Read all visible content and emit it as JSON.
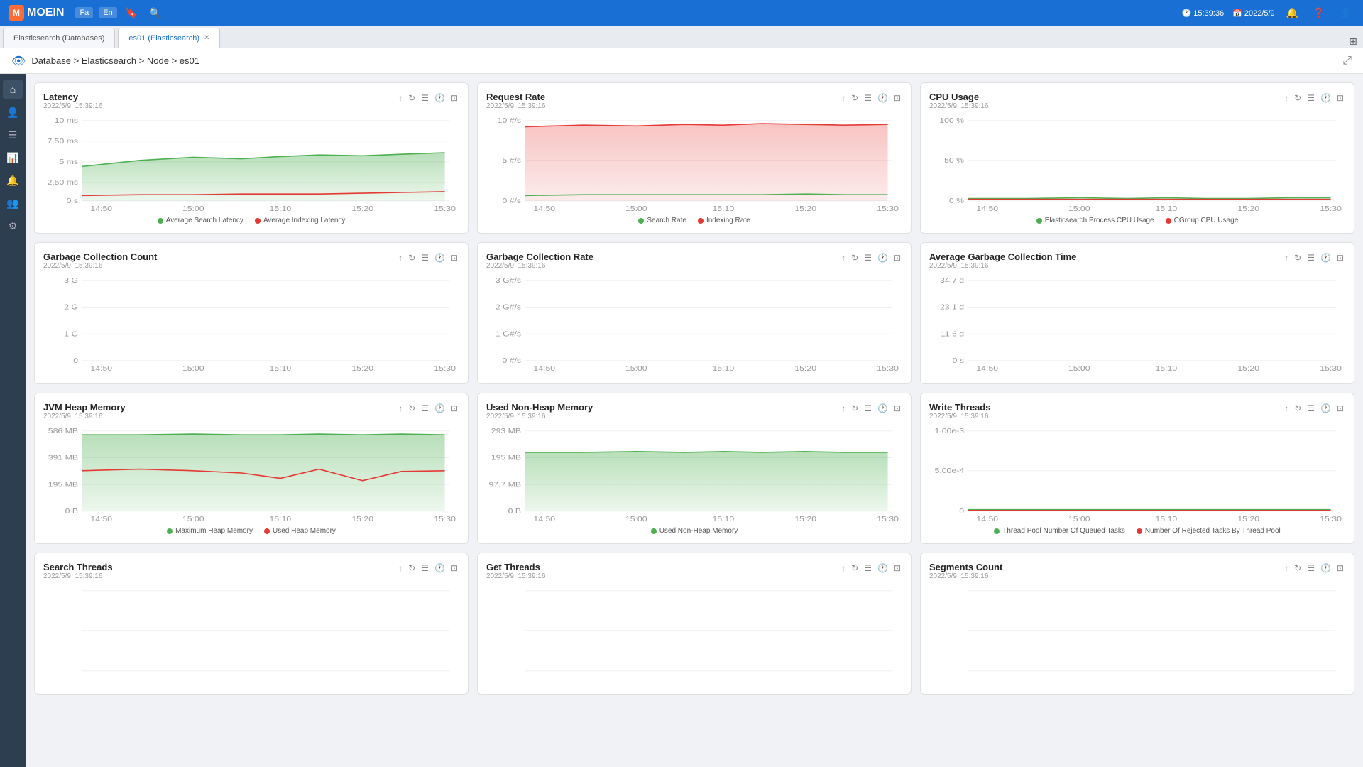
{
  "app": {
    "name": "MOEIN",
    "time": "15:39:36",
    "date": "2022/5/9"
  },
  "tabs": [
    {
      "id": "tab1",
      "label": "Elasticsearch (Databases)",
      "active": false,
      "closable": false
    },
    {
      "id": "tab2",
      "label": "es01 (Elasticsearch)",
      "active": true,
      "closable": true
    }
  ],
  "breadcrumb": "Database > Elasticsearch > Node > es01",
  "lang": {
    "fa": "Fa",
    "en": "En"
  },
  "charts": [
    {
      "id": "latency",
      "title": "Latency",
      "date": "2022/5/9  15:39:16",
      "yLabels": [
        "10 ms",
        "7.50 ms",
        "5 ms",
        "2.50 ms",
        "0 s"
      ],
      "xLabels": [
        "14:50",
        "15:00",
        "15:10",
        "15:20",
        "15:30"
      ],
      "legend": [
        {
          "color": "#4caf50",
          "label": "Average Search Latency"
        },
        {
          "color": "#e53935",
          "label": "Average Indexing Latency"
        }
      ],
      "type": "latency"
    },
    {
      "id": "request-rate",
      "title": "Request Rate",
      "date": "2022/5/9  15:39:16",
      "yLabels": [
        "10 #/s",
        "5 #/s",
        "0 #/s"
      ],
      "xLabels": [
        "14:50",
        "15:00",
        "15:10",
        "15:20",
        "15:30"
      ],
      "legend": [
        {
          "color": "#4caf50",
          "label": "Search Rate"
        },
        {
          "color": "#e53935",
          "label": "Indexing Rate"
        }
      ],
      "type": "request-rate"
    },
    {
      "id": "cpu-usage",
      "title": "CPU Usage",
      "date": "2022/5/9  15:39:16",
      "yLabels": [
        "100 %",
        "50 %",
        "0 %"
      ],
      "xLabels": [
        "14:50",
        "15:00",
        "15:10",
        "15:20",
        "15:30"
      ],
      "legend": [
        {
          "color": "#4caf50",
          "label": "Elasticsearch Process CPU Usage"
        },
        {
          "color": "#e53935",
          "label": "CGroup CPU Usage"
        }
      ],
      "type": "cpu-usage"
    },
    {
      "id": "gc-count",
      "title": "Garbage Collection Count",
      "date": "2022/5/9  15:39:16",
      "yLabels": [
        "3 G",
        "2 G",
        "1 G",
        "0"
      ],
      "xLabels": [
        "14:50",
        "15:00",
        "15:10",
        "15:20",
        "15:30"
      ],
      "legend": [],
      "type": "empty"
    },
    {
      "id": "gc-rate",
      "title": "Garbage Collection Rate",
      "date": "2022/5/9  15:39:16",
      "yLabels": [
        "3 G#/s",
        "2 G#/s",
        "1 G#/s",
        "0 #/s"
      ],
      "xLabels": [
        "14:50",
        "15:00",
        "15:10",
        "15:20",
        "15:30"
      ],
      "legend": [],
      "type": "empty"
    },
    {
      "id": "avg-gc-time",
      "title": "Average Garbage Collection Time",
      "date": "2022/5/9  15:39:16",
      "yLabels": [
        "34.7 d",
        "23.1 d",
        "11.6 d",
        "0 s"
      ],
      "xLabels": [
        "14:50",
        "15:00",
        "15:10",
        "15:20",
        "15:30"
      ],
      "legend": [],
      "type": "empty"
    },
    {
      "id": "jvm-heap",
      "title": "JVM Heap Memory",
      "date": "2022/5/9  15:39:16",
      "yLabels": [
        "586 MB",
        "391 MB",
        "195 MB",
        "0 B"
      ],
      "xLabels": [
        "14:50",
        "15:00",
        "15:10",
        "15:20",
        "15:30"
      ],
      "legend": [
        {
          "color": "#4caf50",
          "label": "Maximum Heap Memory"
        },
        {
          "color": "#e53935",
          "label": "Used Heap Memory"
        }
      ],
      "type": "jvm-heap"
    },
    {
      "id": "non-heap",
      "title": "Used Non-Heap Memory",
      "date": "2022/5/9  15:39:16",
      "yLabels": [
        "293 MB",
        "195 MB",
        "97.7 MB",
        "0 B"
      ],
      "xLabels": [
        "14:50",
        "15:00",
        "15:10",
        "15:20",
        "15:30"
      ],
      "legend": [
        {
          "color": "#4caf50",
          "label": "Used Non-Heap Memory"
        }
      ],
      "type": "non-heap"
    },
    {
      "id": "write-threads",
      "title": "Write Threads",
      "date": "2022/5/9  15:39:16",
      "yLabels": [
        "1.00e-3",
        "5.00e-4",
        "0"
      ],
      "xLabels": [
        "14:50",
        "15:00",
        "15:10",
        "15:20",
        "15:30"
      ],
      "legend": [
        {
          "color": "#4caf50",
          "label": "Thread Pool Number Of Queued Tasks"
        },
        {
          "color": "#e53935",
          "label": "Number Of Rejected Tasks By Thread Pool"
        }
      ],
      "type": "write-threads"
    },
    {
      "id": "search-threads",
      "title": "Search Threads",
      "date": "2022/5/9  15:39:16",
      "yLabels": [],
      "xLabels": [],
      "legend": [],
      "type": "empty"
    },
    {
      "id": "get-threads",
      "title": "Get Threads",
      "date": "2022/5/9  15:39:16",
      "yLabels": [],
      "xLabels": [],
      "legend": [],
      "type": "empty"
    },
    {
      "id": "segments-count",
      "title": "Segments Count",
      "date": "2022/5/9  15:39:16",
      "yLabels": [],
      "xLabels": [],
      "legend": [],
      "type": "empty"
    }
  ],
  "sidebar_icons": [
    {
      "name": "home",
      "symbol": "⌂"
    },
    {
      "name": "users",
      "symbol": "👤"
    },
    {
      "name": "list",
      "symbol": "☰"
    },
    {
      "name": "chart",
      "symbol": "📊"
    },
    {
      "name": "bell",
      "symbol": "🔔"
    },
    {
      "name": "person",
      "symbol": "👥"
    },
    {
      "name": "settings",
      "symbol": "⚙"
    }
  ]
}
